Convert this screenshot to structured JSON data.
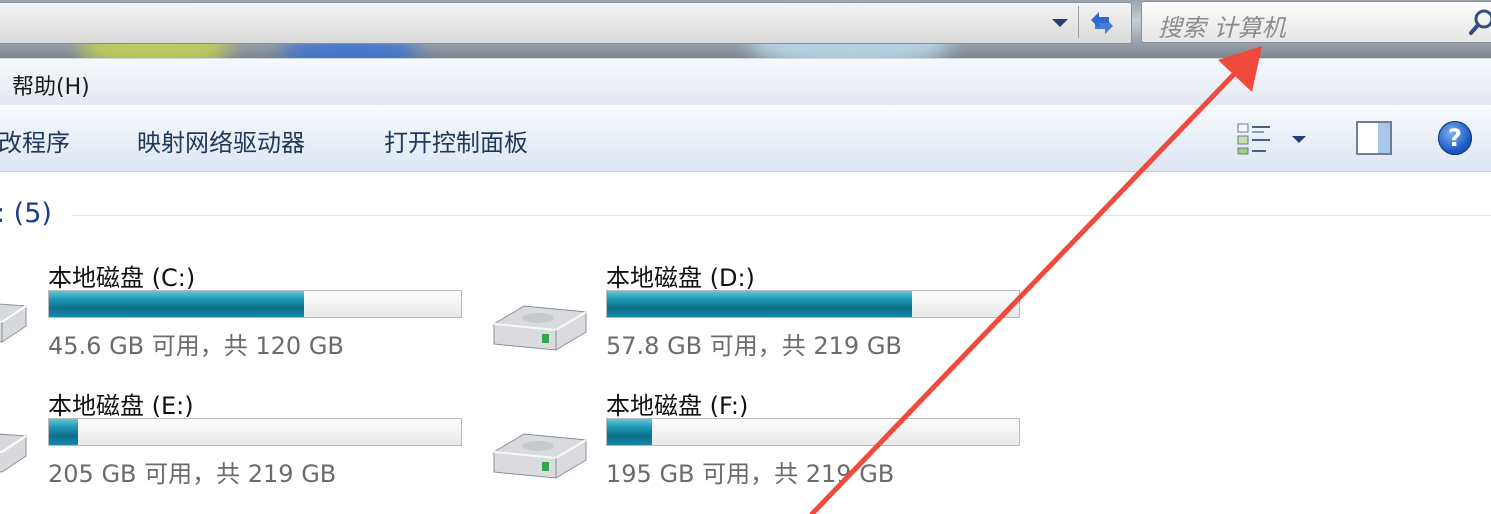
{
  "search": {
    "placeholder": "搜索 计算机"
  },
  "menu": {
    "items": [
      "帮助(H)"
    ]
  },
  "toolbar": {
    "buttons": [
      "改程序",
      "映射网络驱动器",
      "打开控制面板"
    ]
  },
  "group": {
    "header": ": (5)"
  },
  "drives": [
    {
      "name": "本地磁盘 (C:)",
      "free": "45.6 GB 可用，共 120 GB",
      "used_fraction": 0.62
    },
    {
      "name": "本地磁盘 (D:)",
      "free": "57.8 GB 可用，共 219 GB",
      "used_fraction": 0.74
    },
    {
      "name": "本地磁盘 (E:)",
      "free": "205 GB 可用，共 219 GB",
      "used_fraction": 0.07
    },
    {
      "name": "本地磁盘 (F:)",
      "free": "195 GB 可用，共 219 GB",
      "used_fraction": 0.11
    }
  ],
  "colors": {
    "annotation_arrow": "#f04a3c",
    "group_header": "#1e3b8c"
  }
}
